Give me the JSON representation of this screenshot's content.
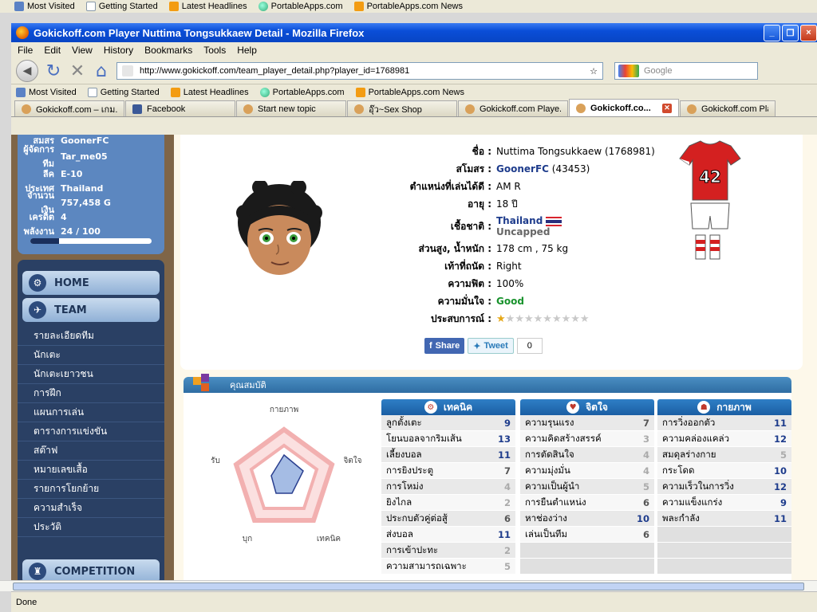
{
  "outer_bookmarks": [
    "Most Visited",
    "Getting Started",
    "Latest Headlines",
    "PortableApps.com",
    "PortableApps.com News"
  ],
  "window": {
    "title": "Gokickoff.com Player Nuttima Tongsukkaew Detail - Mozilla Firefox",
    "controls": {
      "minimize": "_",
      "maximize": "❐",
      "close": "×"
    }
  },
  "menubar": [
    "File",
    "Edit",
    "View",
    "History",
    "Bookmarks",
    "Tools",
    "Help"
  ],
  "navbar": {
    "url": "http://www.gokickoff.com/team_player_detail.php?player_id=1768981",
    "search_placeholder": "Google"
  },
  "bookmarks": [
    "Most Visited",
    "Getting Started",
    "Latest Headlines",
    "PortableApps.com",
    "PortableApps.com News"
  ],
  "tabs": [
    {
      "label": "Gokickoff.com – เกม...",
      "icon": "gokickoff-icon"
    },
    {
      "label": "Facebook",
      "icon": "facebook-icon"
    },
    {
      "label": "Start new topic",
      "icon": "gokickoff-icon"
    },
    {
      "label": "อุ๊ว~Sex Shop",
      "icon": "gokickoff-icon"
    },
    {
      "label": "Gokickoff.com Playe...",
      "icon": "gokickoff-icon"
    },
    {
      "label": "Gokickoff.co...",
      "icon": "gokickoff-icon",
      "active": true
    },
    {
      "label": "Gokickoff.com Playe...",
      "icon": "gokickoff-icon"
    }
  ],
  "profile": {
    "rows": [
      {
        "label": "สมสร",
        "value": "GoonerFC"
      },
      {
        "label": "ผู้จัดการทีม",
        "value": "Tar_me05"
      },
      {
        "label": "ลีค",
        "value": "E-10"
      },
      {
        "label": "ประเทศ",
        "value": "Thailand"
      },
      {
        "label": "จำนวนเงิน",
        "value": "757,458 G"
      },
      {
        "label": "เครดิต",
        "value": "4"
      },
      {
        "label": "พลังงาน",
        "value": "24 / 100"
      }
    ],
    "energy_fraction": 0.24
  },
  "nav": {
    "home": "HOME",
    "team": "TEAM",
    "team_items": [
      "รายละเอียดทีม",
      "นักเตะ",
      "นักเตะเยาวชน",
      "การฝึก",
      "แผนการเล่น",
      "ตารางการแข่งขัน",
      "สต๊าฟ",
      "หมายเลขเสื้อ",
      "รายการโยกย้าย",
      "ความสำเร็จ",
      "ประวัติ"
    ],
    "competition": "COMPETITION"
  },
  "player": {
    "name_label": "ชื่อ :",
    "name": "Nuttima Tongsukkaew (1768981)",
    "club_label": "สโมสร :",
    "club": "GoonerFC",
    "club_id": "(43453)",
    "position_label": "ตำแหน่งที่เล่นได้ดี :",
    "position": "AM R",
    "age_label": "อายุ :",
    "age": "18 ปี",
    "nationality_label": "เชื้อชาติ :",
    "nationality": "Thailand",
    "caps": "Uncapped",
    "height_weight_label": "ส่วนสูง, น้ำหนัก :",
    "height_weight": "178 cm , 75 kg",
    "foot_label": "เท้าที่ถนัด :",
    "foot": "Right",
    "fitness_label": "ความฟิต :",
    "fitness": "100%",
    "morale_label": "ความมั่นใจ :",
    "morale": "Good",
    "experience_label": "ประสบการณ์ :",
    "experience_stars": 1,
    "experience_max": 10,
    "shirt_number": "42"
  },
  "social": {
    "share": "Share",
    "tweet": "Tweet",
    "count": "0"
  },
  "attributes": {
    "header": "คุณสมบัติ",
    "radar_labels": {
      "top": "กายภาพ",
      "right": "จิตใจ",
      "bottom_right": "เทคนิค",
      "bottom_left": "บุก",
      "left": "รับ"
    },
    "technique": {
      "title": "เทคนิค",
      "rows": [
        {
          "name": "ลูกตั้งเตะ",
          "value": 9
        },
        {
          "name": "โยนบอลจากริมเส้น",
          "value": 13
        },
        {
          "name": "เลี้ยงบอล",
          "value": 11
        },
        {
          "name": "การยิงประตู",
          "value": 7
        },
        {
          "name": "การโหม่ง",
          "value": 4
        },
        {
          "name": "ยิงไกล",
          "value": 2
        },
        {
          "name": "ประกบตัวคู่ต่อสู้",
          "value": 6
        },
        {
          "name": "ส่งบอล",
          "value": 11
        },
        {
          "name": "การเข้าปะทะ",
          "value": 2
        },
        {
          "name": "ความสามารถเฉพาะ",
          "value": 5
        }
      ]
    },
    "mental": {
      "title": "จิตใจ",
      "rows": [
        {
          "name": "ความรุนแรง",
          "value": 7
        },
        {
          "name": "ความคิดสร้างสรรค์",
          "value": 3
        },
        {
          "name": "การตัดสินใจ",
          "value": 4
        },
        {
          "name": "ความมุ่งมั่น",
          "value": 4
        },
        {
          "name": "ความเป็นผู้นำ",
          "value": 5
        },
        {
          "name": "การยืนตำแหน่ง",
          "value": 6
        },
        {
          "name": "หาช่องว่าง",
          "value": 10
        },
        {
          "name": "เล่นเป็นทีม",
          "value": 6
        }
      ]
    },
    "physical": {
      "title": "กายภาพ",
      "rows": [
        {
          "name": "การวิ่งออกตัว",
          "value": 11
        },
        {
          "name": "ความคล่องแคล่ว",
          "value": 12
        },
        {
          "name": "สมดุลร่างกาย",
          "value": 5
        },
        {
          "name": "กระโดด",
          "value": 10
        },
        {
          "name": "ความเร็วในการวิ่ง",
          "value": 12
        },
        {
          "name": "ความแข็งแกร่ง",
          "value": 9
        },
        {
          "name": "พละกำลัง",
          "value": 11
        }
      ]
    }
  },
  "status": "Done"
}
